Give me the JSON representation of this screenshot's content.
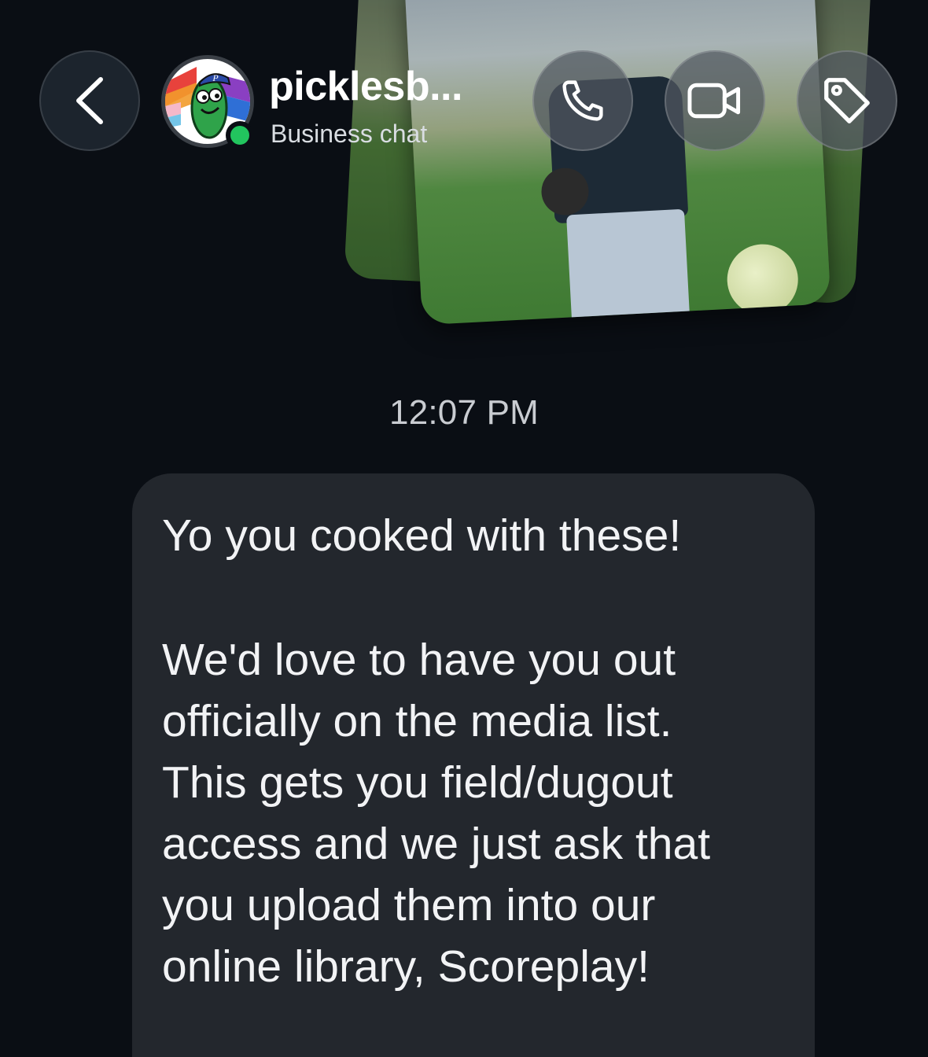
{
  "header": {
    "contact_name": "picklesb...",
    "subtitle": "Business chat",
    "icons": {
      "back": "chevron-left-icon",
      "call": "phone-icon",
      "video": "video-camera-icon",
      "label": "tag-icon"
    },
    "online_status_color": "#22c55e"
  },
  "conversation": {
    "timestamp": "12:07 PM",
    "message": {
      "paragraph_1": "Yo you cooked with these!",
      "paragraph_2": "We'd love to have you out\nofficially on the media list.\nThis gets you field/dugout\naccess and we just ask that\nyou upload them into our\nonline library, Scoreplay!"
    }
  },
  "colors": {
    "background": "#0a0e14",
    "bubble": "#23272d",
    "text_primary": "#ffffff",
    "text_secondary": "#c9ccd1"
  }
}
